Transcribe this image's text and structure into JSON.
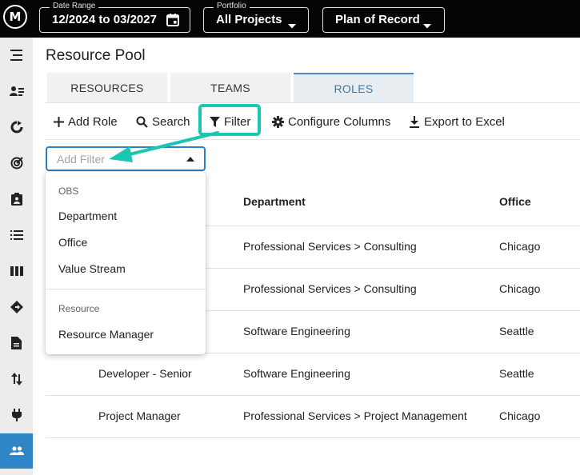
{
  "topbar": {
    "logo_text": "M",
    "date_range": {
      "legend": "Date Range",
      "value": "12/2024 to 03/2027"
    },
    "portfolio": {
      "legend": "Portfolio",
      "value": "All Projects"
    },
    "plan": {
      "value": "Plan of Record"
    }
  },
  "sidebar": {
    "items": [
      {
        "icon": "menu-icon"
      },
      {
        "icon": "resource-list-icon"
      },
      {
        "icon": "cycle-icon"
      },
      {
        "icon": "target-icon"
      },
      {
        "icon": "assignment-icon"
      },
      {
        "icon": "list-icon"
      },
      {
        "icon": "board-icon"
      },
      {
        "icon": "direction-icon"
      },
      {
        "icon": "document-icon"
      },
      {
        "icon": "swap-icon"
      },
      {
        "icon": "plug-icon"
      },
      {
        "icon": "people-icon",
        "active": true
      }
    ],
    "active_color": "#2f86c6"
  },
  "page": {
    "title": "Resource Pool",
    "tabs": [
      "RESOURCES",
      "TEAMS",
      "ROLES"
    ],
    "active_tab": "ROLES"
  },
  "toolbar": {
    "add_role": "Add Role",
    "search": "Search",
    "filter": "Filter",
    "configure_columns": "Configure Columns",
    "export": "Export to Excel",
    "highlight_color": "#1cc7b1"
  },
  "filter": {
    "placeholder": "Add Filter",
    "menu": {
      "groups": [
        {
          "label": "OBS",
          "items": [
            "Department",
            "Office",
            "Value Stream"
          ]
        },
        {
          "label": "Resource",
          "items": [
            "Resource Manager"
          ]
        }
      ]
    }
  },
  "table": {
    "headers": [
      "Department",
      "Office"
    ],
    "rows": [
      {
        "role": "",
        "department": "Professional Services > Consulting",
        "office": "Chicago"
      },
      {
        "role": "",
        "department": "Professional Services > Consulting",
        "office": "Chicago"
      },
      {
        "role": "",
        "department": "Software Engineering",
        "office": "Seattle"
      },
      {
        "role": "Developer - Senior",
        "department": "Software Engineering",
        "office": "Seattle"
      },
      {
        "role": "Project Manager",
        "department": "Professional Services > Project Management",
        "office": "Chicago"
      }
    ]
  }
}
